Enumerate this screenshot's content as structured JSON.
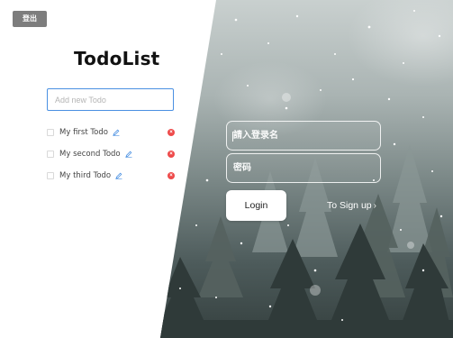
{
  "header": {
    "logout_label": "登出"
  },
  "todo": {
    "title": "TodoList",
    "new_todo_placeholder": "Add new Todo",
    "items": [
      {
        "text": "My first Todo"
      },
      {
        "text": "My second Todo"
      },
      {
        "text": "My third Todo"
      }
    ]
  },
  "login": {
    "username_placeholder": "請入登录名",
    "password_placeholder": "密码",
    "login_label": "Login",
    "signup_label": "To Sign up",
    "signup_chevron": "›"
  },
  "colors": {
    "accent_blue": "#4a90e2",
    "delete_red": "#ee4a4a",
    "logout_gray": "#7d7d7d"
  },
  "icons": {
    "edit": "pencil-icon",
    "delete": "close-circle-icon",
    "signup_arrow": "chevron-right-icon"
  }
}
